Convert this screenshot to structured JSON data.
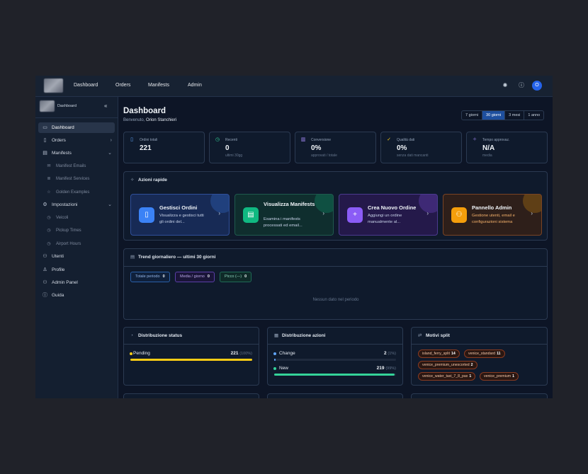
{
  "topbar": {
    "nav": [
      "Dashboard",
      "Orders",
      "Manifests",
      "Admin"
    ],
    "avatar_initial": "O"
  },
  "sidebar": {
    "title": "Dashboard",
    "items": [
      {
        "label": "Dashboard",
        "icon": "folder-icon",
        "active": true
      },
      {
        "label": "Orders",
        "icon": "clipboard-icon",
        "chevron": "right"
      },
      {
        "label": "Manifests",
        "icon": "file-icon",
        "chevron": "down"
      },
      {
        "label": "Manifest Emails",
        "icon": "mail-icon",
        "sub": true
      },
      {
        "label": "Manifest Services",
        "icon": "list-icon",
        "sub": true
      },
      {
        "label": "Golden Examples",
        "icon": "star-icon",
        "sub": true
      },
      {
        "label": "Impostazioni",
        "icon": "gear-icon",
        "chevron": "down"
      },
      {
        "label": "Veicoli",
        "icon": "clock-icon",
        "sub": true
      },
      {
        "label": "Pickup Times",
        "icon": "clock-icon",
        "sub": true
      },
      {
        "label": "Airport Hours",
        "icon": "clock-icon",
        "sub": true
      },
      {
        "label": "Utenti",
        "icon": "users-icon"
      },
      {
        "label": "Profile",
        "icon": "user-icon"
      },
      {
        "label": "Admin Panel",
        "icon": "admin-icon"
      },
      {
        "label": "Guida",
        "icon": "info-icon"
      }
    ]
  },
  "header": {
    "title": "Dashboard",
    "welcome_prefix": "Benvenuto,",
    "user_name": "Orion Stanchieri",
    "ranges": [
      "7 giorni",
      "30 giorni",
      "3 mesi",
      "1 anno"
    ],
    "active_range": "30 giorni"
  },
  "stats": [
    {
      "label": "Ordini totali",
      "value": "221",
      "sub": "",
      "icon": "clipboard-icon",
      "color": "#60a5fa"
    },
    {
      "label": "Recenti",
      "value": "0",
      "sub": "ultimi 30gg",
      "icon": "clock-icon",
      "color": "#34d399"
    },
    {
      "label": "Conversione",
      "value": "0%",
      "sub": "approvati / totale",
      "icon": "chart-icon",
      "color": "#a78bfa"
    },
    {
      "label": "Qualità dati",
      "value": "0%",
      "sub": "senza dati mancanti",
      "icon": "check-circle-icon",
      "color": "#facc15"
    },
    {
      "label": "Tempo approvaz.",
      "value": "N/A",
      "sub": "media",
      "icon": "sparkle-icon",
      "color": "#a78bfa"
    }
  ],
  "quick_actions": {
    "title": "Azioni rapide",
    "items": [
      {
        "title": "Gestisci Ordini",
        "desc": "Visualizza e gestisci tutti gli ordini del...",
        "icon": "clipboard-icon",
        "bg": "#172a55",
        "border": "#2f4f9a",
        "icon_bg": "#3b82f6",
        "desc_color": "#c7d2e8"
      },
      {
        "title": "Visualizza Manifests",
        "desc": "Esamina i manifests processati ed email...",
        "icon": "file-icon",
        "bg": "#0f2e2e",
        "border": "#1f5a4d",
        "icon_bg": "#10b981",
        "desc_color": "#c7d2e8"
      },
      {
        "title": "Crea Nuovo Ordine",
        "desc": "Aggiungi un ordine manualmente al...",
        "icon": "plus-icon",
        "bg": "#24194a",
        "border": "#4b3a8f",
        "icon_bg": "#8b5cf6",
        "desc_color": "#c7d2e8"
      },
      {
        "title": "Pannello Admin",
        "desc": "Gestione utenti, email e configurazioni sistema",
        "icon": "admin-icon",
        "bg": "#2e1f1a",
        "border": "#7a4424",
        "icon_bg": "#f59e0b",
        "desc_color": "#f6b26b"
      }
    ]
  },
  "trend": {
    "title": "Trend giornaliero — ultimi 30 giorni",
    "pills": [
      {
        "label": "Totale periodo",
        "value": "0",
        "border": "#2a5fa8",
        "bg": "#0f203b",
        "color": "#93b4e6"
      },
      {
        "label": "Media / giorno",
        "value": "0",
        "border": "#5b3fa8",
        "bg": "#1a1538",
        "color": "#b7a6e6"
      },
      {
        "label": "Picco (—)",
        "value": "0",
        "border": "#1f6b57",
        "bg": "#0f2a28",
        "color": "#8fd6bf"
      }
    ],
    "empty_text": "Nessun dato nel periodo"
  },
  "status_distribution": {
    "title": "Distribuzione status",
    "rows": [
      {
        "label": "Pending",
        "value": "221",
        "pct": "(100%)",
        "fraction": 1.0,
        "color": "#facc15"
      }
    ]
  },
  "action_distribution": {
    "title": "Distribuzione azioni",
    "rows": [
      {
        "label": "Change",
        "value": "2",
        "pct": "(1%)",
        "fraction": 0.01,
        "color": "#60a5fa"
      },
      {
        "label": "New",
        "value": "219",
        "pct": "(99%)",
        "fraction": 0.99,
        "color": "#34d399"
      }
    ]
  },
  "split_reasons": {
    "title": "Motivi split",
    "tags": [
      {
        "label": "island_ferry_split",
        "count": "14"
      },
      {
        "label": "venice_standard",
        "count": "11"
      },
      {
        "label": "venice_premium_unescorted",
        "count": "2"
      },
      {
        "label": "venice_water_taxi_7_8_pax",
        "count": "1"
      },
      {
        "label": "venice_premium",
        "count": "1"
      }
    ]
  }
}
